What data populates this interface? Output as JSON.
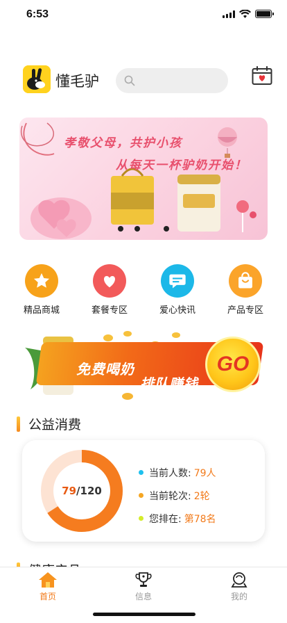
{
  "status_bar": {
    "time": "6:53",
    "icons": [
      "signal-icon",
      "wifi-icon",
      "battery-icon"
    ]
  },
  "header": {
    "app_name": "懂毛驴",
    "search_placeholder": "",
    "icons": [
      "logo-icon",
      "search-icon",
      "calendar-heart-icon"
    ]
  },
  "banner": {
    "line1": "孝敬父母，共护小孩",
    "line2": "从每天一杯驴奶开始！"
  },
  "categories": [
    {
      "label": "精品商城",
      "icon": "star-icon",
      "color": "#f7a21a"
    },
    {
      "label": "套餐专区",
      "icon": "heart-icon",
      "color": "#f25a5a"
    },
    {
      "label": "爱心快讯",
      "icon": "message-icon",
      "color": "#1cb8e8"
    },
    {
      "label": "产品专区",
      "icon": "shopping-bag-icon",
      "color": "#fba42a"
    }
  ],
  "promo": {
    "text1": "免费喝奶",
    "text2": "排队赚钱",
    "go": "GO"
  },
  "section_charity": {
    "title": "公益消费"
  },
  "charity": {
    "current": "79",
    "separator": "/",
    "total": "120",
    "progress": 0.658,
    "stats": [
      {
        "label": "当前人数:",
        "value": "79人",
        "dot_color": "#1ec0ee"
      },
      {
        "label": "当前轮次:",
        "value": "2轮",
        "dot_color": "#f5a623"
      },
      {
        "label": "您排在:",
        "value": "第78名",
        "dot_color": "#d4ec2b"
      }
    ]
  },
  "section_health": {
    "title": "健康产品"
  },
  "tabbar": {
    "tabs": [
      {
        "label": "首页",
        "icon": "home-icon",
        "active": true
      },
      {
        "label": "信息",
        "icon": "trophy-icon",
        "active": false
      },
      {
        "label": "我的",
        "icon": "profile-icon",
        "active": false
      }
    ]
  },
  "colors": {
    "accent": "#f27a1a",
    "donut_track": "#fde3d3",
    "donut_fill": "#f57c1f"
  }
}
